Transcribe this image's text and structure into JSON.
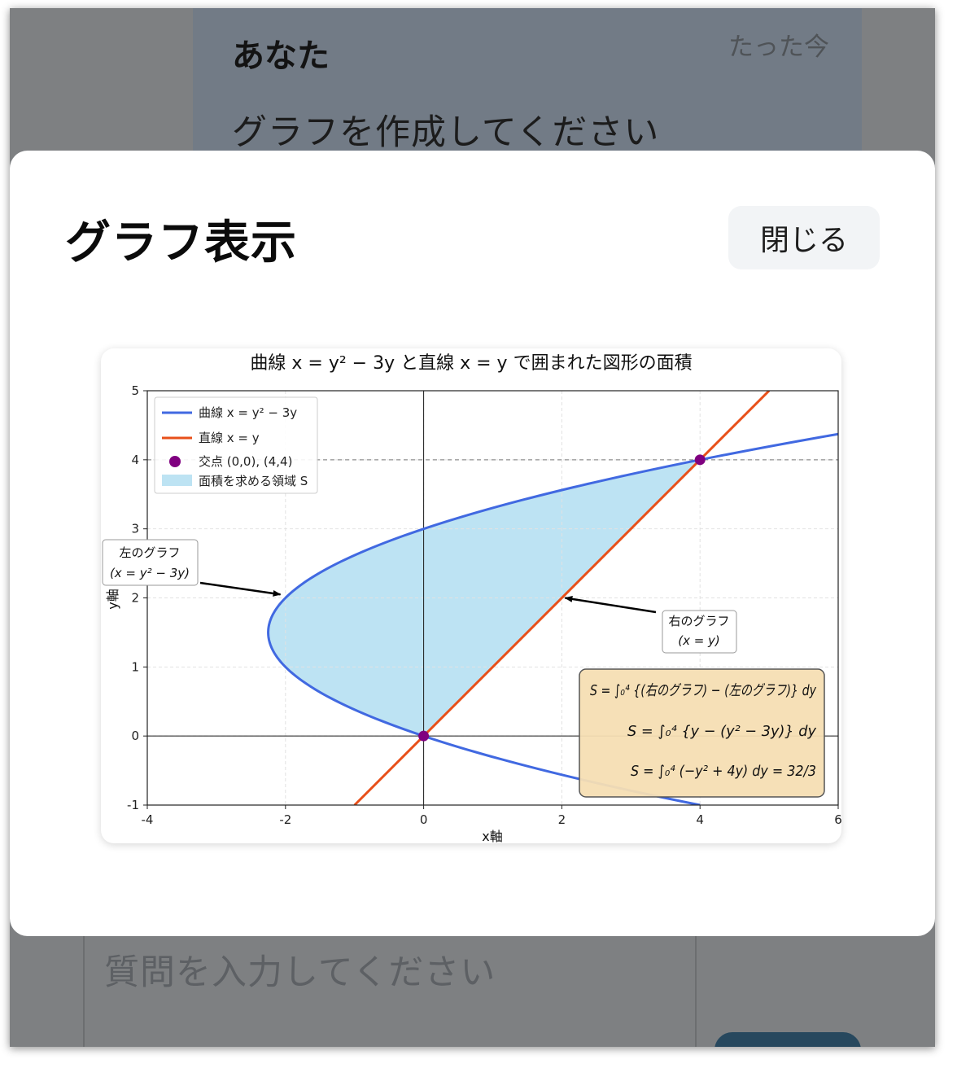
{
  "chat": {
    "message": {
      "sender": "あなた",
      "time": "たった今",
      "text": "グラフを作成してください"
    },
    "input": {
      "placeholder": "質問を入力してください"
    }
  },
  "modal": {
    "title": "グラフ表示",
    "close_label": "閉じる"
  },
  "chart_data": {
    "type": "line",
    "title": "曲線 x = y² − 3y と直線 x = y で囲まれた図形の面積",
    "xlabel": "x軸",
    "ylabel": "y軸",
    "xlim": [
      -4,
      6
    ],
    "ylim": [
      -1,
      5
    ],
    "xticks": [
      "-4",
      "-2",
      "0",
      "2",
      "4",
      "6"
    ],
    "yticks": [
      "-1",
      "0",
      "1",
      "2",
      "3",
      "4",
      "5"
    ],
    "grid": true,
    "legend_position": "upper-left",
    "series": [
      {
        "name": "曲線 x = y² − 3y",
        "color": "#4169e1",
        "equation": "x = y^2 - 3y"
      },
      {
        "name": "直線 x = y",
        "color": "#e8501a",
        "equation": "x = y"
      }
    ],
    "intersections": {
      "name": "交点 (0,0), (4,4)",
      "color": "#800080",
      "points": [
        [
          0,
          0
        ],
        [
          4,
          4
        ]
      ]
    },
    "region": {
      "name": "面積を求める領域 S",
      "color": "#bde3f3",
      "y_range": [
        0,
        4
      ]
    },
    "annotations": {
      "left": {
        "line1": "左のグラフ",
        "line2": "(x = y² − 3y)",
        "target": [
          -2.05,
          2.05
        ]
      },
      "right": {
        "line1": "右のグラフ",
        "line2": "(x = y)",
        "target": [
          2.0,
          2.0
        ]
      }
    },
    "formula_lines": [
      "S = ∫₀⁴ {(右のグラフ) − (左のグラフ)} dy",
      "S = ∫₀⁴ {y − (y² − 3y)} dy",
      "S = ∫₀⁴ (−y² + 4y) dy = 32/3"
    ]
  }
}
